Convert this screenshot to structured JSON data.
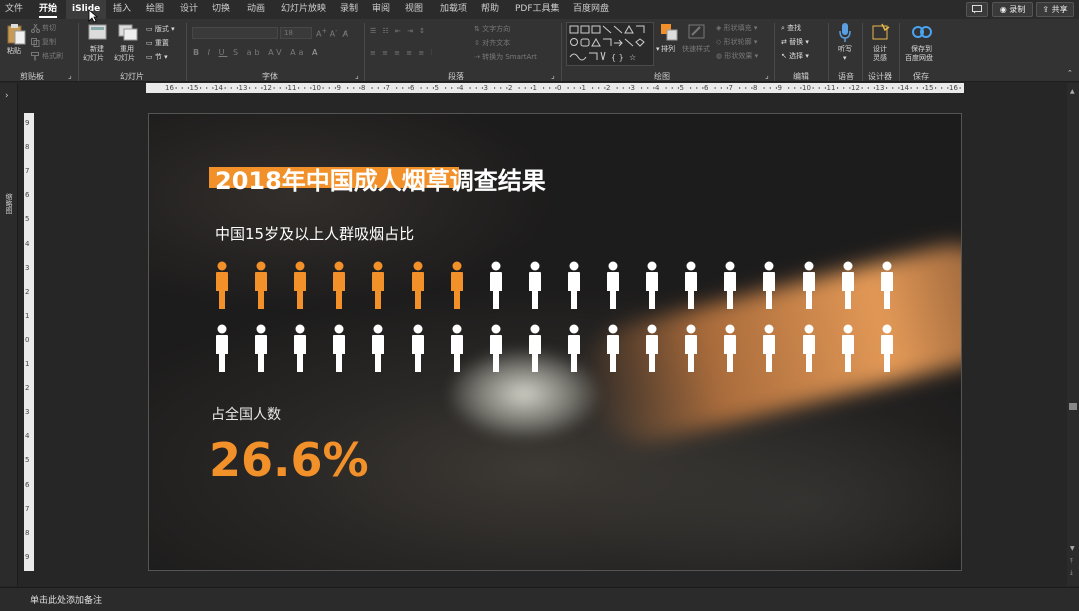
{
  "tabs": [
    {
      "label": "文件",
      "active": false
    },
    {
      "label": "开始",
      "active": true
    },
    {
      "label": "iSlide",
      "active": false
    },
    {
      "label": "插入",
      "active": false
    },
    {
      "label": "绘图",
      "active": false
    },
    {
      "label": "设计",
      "active": false
    },
    {
      "label": "切换",
      "active": false
    },
    {
      "label": "动画",
      "active": false
    },
    {
      "label": "幻灯片放映",
      "active": false
    },
    {
      "label": "录制",
      "active": false
    },
    {
      "label": "审阅",
      "active": false
    },
    {
      "label": "视图",
      "active": false
    },
    {
      "label": "加载项",
      "active": false
    },
    {
      "label": "帮助",
      "active": false
    },
    {
      "label": "PDF工具集",
      "active": false
    },
    {
      "label": "百度网盘",
      "active": false
    }
  ],
  "topright": {
    "record": "录制",
    "share": "共享"
  },
  "ribbon": {
    "clipboard": {
      "group": "剪贴板",
      "paste": "粘贴",
      "cut": "剪切",
      "copy": "复制",
      "format_painter": "格式刷"
    },
    "slides": {
      "group": "幻灯片",
      "new_slide": "新建",
      "new_slide2": "幻灯片",
      "reuse": "重用",
      "reuse2": "幻灯片",
      "layout": "版式",
      "reset": "重置",
      "section": "节"
    },
    "font": {
      "group": "字体",
      "size": "18"
    },
    "paragraph": {
      "group": "段落",
      "text_direction": "文字方向",
      "align_text": "对齐文本",
      "smartart": "转换为 SmartArt"
    },
    "drawing": {
      "group": "绘图",
      "arrange": "排列",
      "quick_styles": "快速样式",
      "fill": "形状填充",
      "outline": "形状轮廓",
      "effects": "形状效果"
    },
    "editing": {
      "group": "编辑",
      "find": "查找",
      "replace": "替换",
      "select": "选择"
    },
    "voice": {
      "group": "语音",
      "dictate": "听写"
    },
    "designer": {
      "group": "设计器",
      "ideas": "设计",
      "ideas2": "灵感"
    },
    "save": {
      "group": "保存",
      "save_to": "保存到",
      "save_to2": "百度网盘"
    }
  },
  "ruler_numbers": [
    "16",
    "15",
    "14",
    "13",
    "12",
    "11",
    "10",
    "9",
    "8",
    "7",
    "6",
    "5",
    "4",
    "3",
    "2",
    "1",
    "0",
    "1",
    "2",
    "3",
    "4",
    "5",
    "6",
    "7",
    "8",
    "9",
    "10",
    "11",
    "12",
    "13",
    "14",
    "15",
    "16"
  ],
  "vruler_numbers": [
    "9",
    "8",
    "7",
    "6",
    "5",
    "4",
    "3",
    "2",
    "1",
    "0",
    "1",
    "2",
    "3",
    "4",
    "5",
    "6",
    "7",
    "8",
    "9"
  ],
  "thumbnails_label": "缩略图",
  "slide": {
    "title": "2018年中国成人烟草调查结果",
    "subtitle": "中国15岁及以上人群吸烟占比",
    "percent_label": "占全国人数",
    "percent_value": "26.6%",
    "rows": 2,
    "per_row": 18,
    "highlighted": 7,
    "highlight_color": "#f2902a",
    "normal_color": "#ffffff"
  },
  "notes_placeholder": "单击此处添加备注",
  "colors": {
    "accent": "#f2902a"
  }
}
